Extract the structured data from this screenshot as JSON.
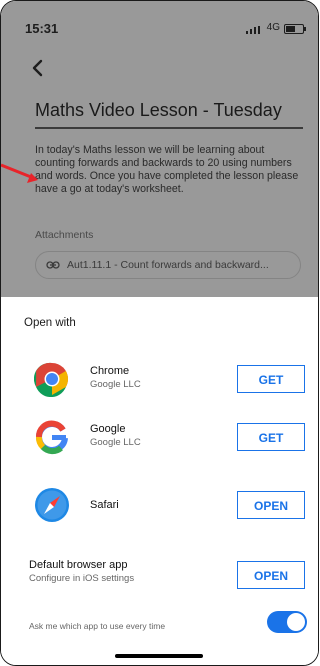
{
  "status_bar": {
    "time": "15:31",
    "network": "4G"
  },
  "post": {
    "title": "Maths Video Lesson - Tuesday",
    "description": "In today's Maths lesson we will be learning about counting forwards and backwards to 20 using numbers and words. Once you have completed the lesson please have a go at today's worksheet.",
    "attachments_label": "Attachments",
    "attachment_name": "Aut1.11.1 - Count forwards and backward..."
  },
  "sheet": {
    "heading": "Open with",
    "apps": [
      {
        "name": "Chrome",
        "company": "Google LLC",
        "action": "GET",
        "icon": "chrome-icon"
      },
      {
        "name": "Google",
        "company": "Google LLC",
        "action": "GET",
        "icon": "google-icon"
      },
      {
        "name": "Safari",
        "company": "",
        "action": "OPEN",
        "icon": "safari-icon"
      }
    ],
    "default_browser": {
      "name": "Default browser app",
      "subtitle": "Configure in iOS settings",
      "action": "OPEN"
    },
    "ask_every_time": {
      "label": "Ask me which app to use every time",
      "enabled": true
    }
  },
  "colors": {
    "accent": "#1a73e8",
    "overlay": "#999999",
    "annotation_arrow": "#e8242a"
  }
}
